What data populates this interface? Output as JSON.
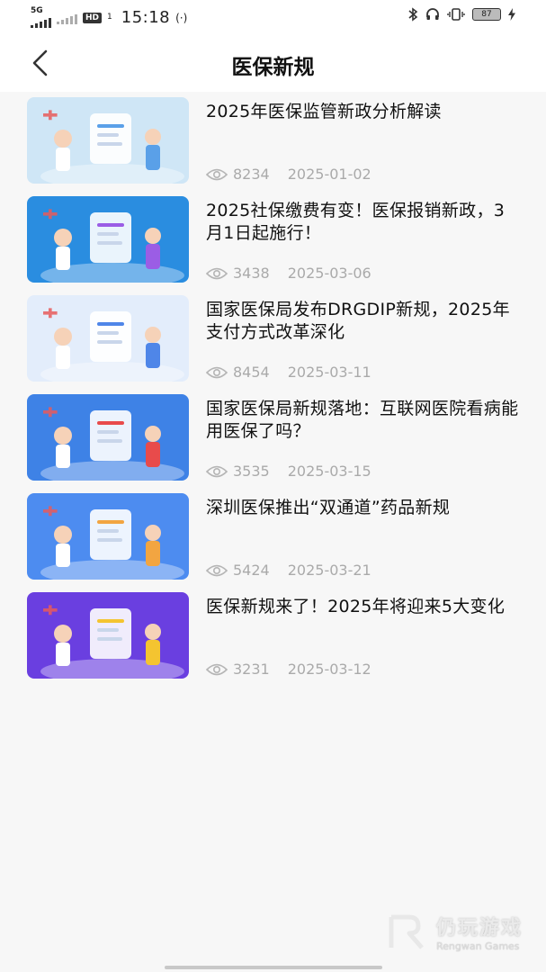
{
  "status_bar": {
    "network_label": "5G",
    "hd_label": "HD",
    "hd_sub": "1",
    "time": "15:18",
    "battery_level": "87"
  },
  "header": {
    "title": "医保新规"
  },
  "articles": [
    {
      "title": "2025年医保监管新政分析解读",
      "views": "8234",
      "date": "2025-01-02",
      "thumb_bg": "#cfe6f6",
      "thumb_accent": "#5aa0e8"
    },
    {
      "title": "2025社保缴费有变！医保报销新政，3月1日起施行！",
      "views": "3438",
      "date": "2025-03-06",
      "thumb_bg": "#2a8de0",
      "thumb_accent": "#9b5de5"
    },
    {
      "title": "国家医保局发布DRGDIP新规，2025年支付方式改革深化",
      "views": "8454",
      "date": "2025-03-11",
      "thumb_bg": "#e3edfb",
      "thumb_accent": "#4f86e8"
    },
    {
      "title": "国家医保局新规落地：互联网医院看病能用医保了吗？",
      "views": "3535",
      "date": "2025-03-15",
      "thumb_bg": "#3e82e6",
      "thumb_accent": "#e84b4b"
    },
    {
      "title": "深圳医保推出“双通道”药品新规",
      "views": "5424",
      "date": "2025-03-21",
      "thumb_bg": "#4d8cf0",
      "thumb_accent": "#f2a541"
    },
    {
      "title": "医保新规来了！2025年将迎来5大变化",
      "views": "3231",
      "date": "2025-03-12",
      "thumb_bg": "#6a3fe0",
      "thumb_accent": "#f4c430"
    }
  ],
  "watermark": {
    "cn": "仍玩游戏",
    "en": "Rengwan Games"
  },
  "icons": {
    "back": "chevron-left-icon",
    "views": "eye-icon"
  }
}
